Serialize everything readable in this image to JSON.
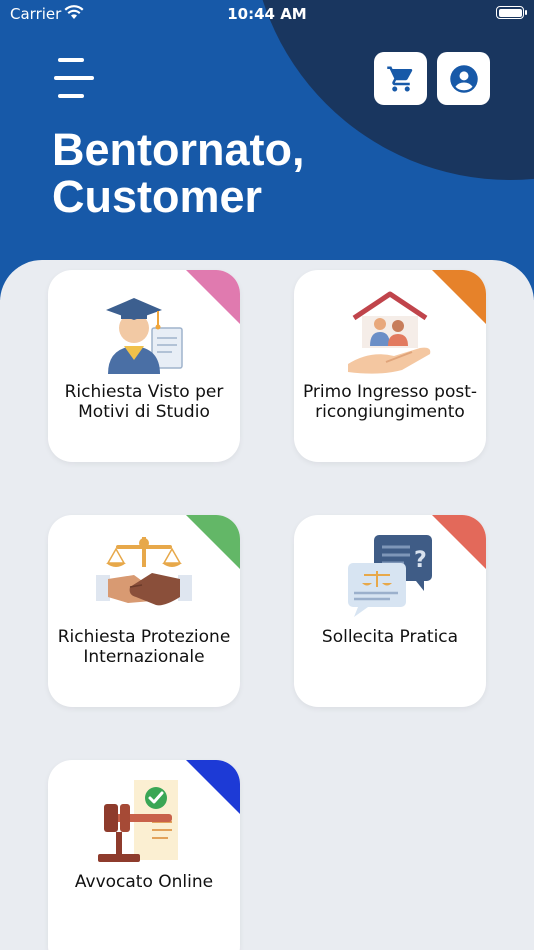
{
  "status_bar": {
    "carrier": "Carrier",
    "time": "10:44 AM"
  },
  "header": {
    "greeting_line1": "Bentornato,",
    "greeting_line2": "Customer",
    "bg_color": "#1759a8",
    "arc_color": "#19365f",
    "icons": {
      "menu": "hamburger-menu-icon",
      "cart": "cart-icon",
      "profile": "account-circle-icon"
    }
  },
  "services": [
    {
      "label": "Richiesta Visto per Motivi di Studio",
      "accent": "#e07aaf",
      "icon": "graduate-icon"
    },
    {
      "label": "Primo Ingresso post-ricongiungimento",
      "accent": "#e6822a",
      "icon": "family-house-icon"
    },
    {
      "label": "Richiesta Protezione Internazionale",
      "accent": "#63b767",
      "icon": "justice-handshake-icon"
    },
    {
      "label": "Sollecita Pratica",
      "accent": "#e3695a",
      "icon": "chat-bubbles-icon"
    },
    {
      "label": "Avvocato Online",
      "accent": "#1d3ad6",
      "icon": "gavel-document-icon"
    }
  ]
}
